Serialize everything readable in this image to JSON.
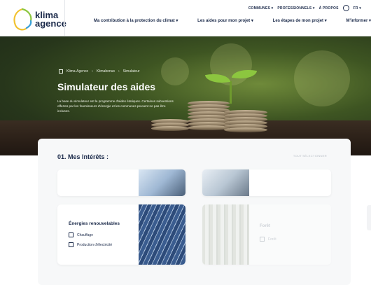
{
  "logo": {
    "line1": "klima",
    "line2": "agence"
  },
  "topnav": {
    "communes": "COMMUNES",
    "professionnels": "PROFESSIONNELS",
    "apropos": "À PROPOS",
    "lang": "FR"
  },
  "mainnav": [
    {
      "label": "Ma contribution à la protection du climat"
    },
    {
      "label": "Les aides pour mon projet"
    },
    {
      "label": "Les étapes de mon projet"
    },
    {
      "label": "M'informer"
    }
  ],
  "breadcrumb": [
    "Klima-Agence",
    "Klimabonus",
    "Simulateur"
  ],
  "hero": {
    "title": "Simulateur des aides",
    "text": "La base du simulateur est le programme d'aides étatiques. Certaines subventions offertes par les fournisseurs d'énergie et les communes peuvent ne pas être incluses."
  },
  "interests": {
    "title": "01. Mes Intérêts :",
    "select_all": "TOUT SÉLECTIONNER",
    "renewables": {
      "title": "Énergies renouvelables",
      "options": [
        "Chauffage",
        "Production d'électricité"
      ]
    },
    "forest": {
      "title": "Forêt",
      "option": "Forêt"
    }
  },
  "colors": {
    "brand_navy": "#1b2a4a",
    "logo_green": "#8cc63f",
    "logo_yellow": "#f2c230",
    "logo_blue": "#3aa0d8"
  }
}
